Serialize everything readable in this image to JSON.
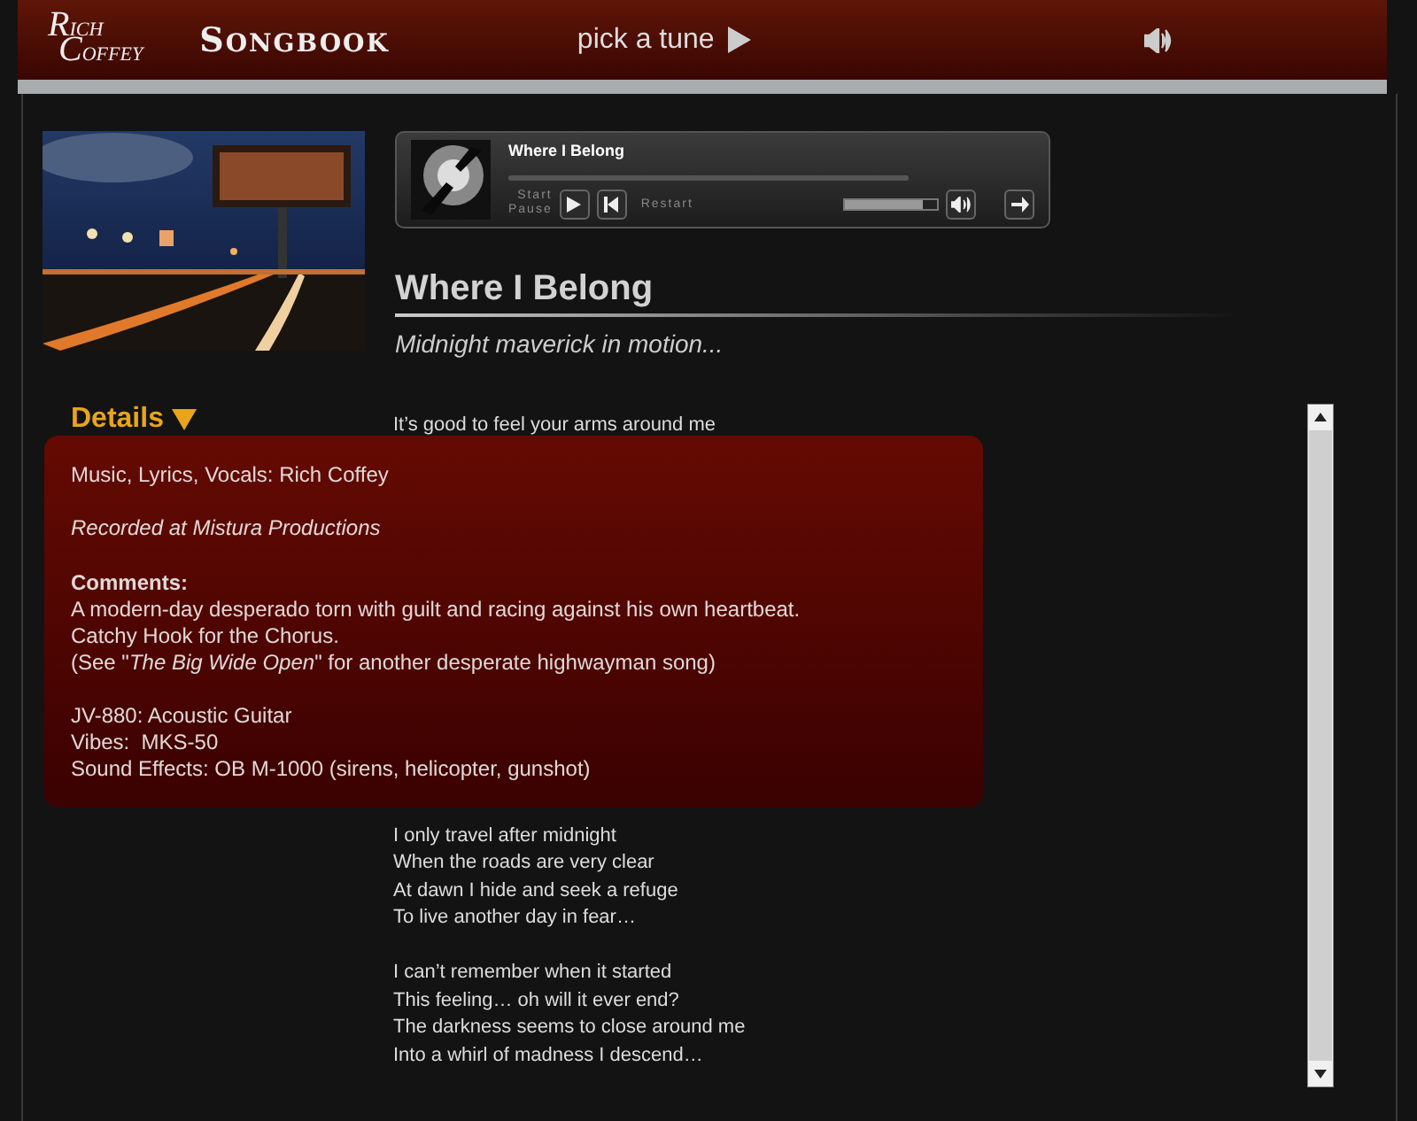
{
  "header": {
    "logo": [
      "RICH",
      "COFFEY"
    ],
    "title": "SONGBOOK",
    "pick_label": "pick a tune"
  },
  "player": {
    "track": "Where I Belong",
    "start_label": "Start",
    "pause_label": "Pause",
    "restart_label": "Restart",
    "volume": {
      "level": 0.85
    }
  },
  "song": {
    "title": "Where I Belong",
    "subtitle": "Midnight maverick in motion..."
  },
  "details": {
    "label": "Details",
    "expanded": true,
    "credits": "Music, Lyrics, Vocals: Rich Coffey",
    "recorded": "Recorded at Mistura Productions",
    "comments_heading": "Comments:",
    "comments": [
      "A modern-day desperado torn with guilt and racing against his own heartbeat.",
      "Catchy Hook for the Chorus.",
      "(See \"*The Big Wide Open*\" for another desperate highwayman song)"
    ],
    "instruments": [
      "JV-880: Acoustic Guitar",
      "Vibes:  MKS-50",
      "Sound Effects: OB M-1000 (sirens, helicopter, gunshot)"
    ]
  },
  "lyrics": {
    "above_overlay": [
      "It’s good to feel your arms around me"
    ],
    "stanzas": [
      [
        "I only travel after midnight",
        "When the roads are very clear",
        "At dawn I hide and seek a refuge",
        "To live another day in fear…"
      ],
      [
        "I can’t remember when it started",
        "This feeling… oh will it ever end?",
        "The darkness seems to close around me",
        "Into a whirl of madness I descend…"
      ]
    ]
  }
}
